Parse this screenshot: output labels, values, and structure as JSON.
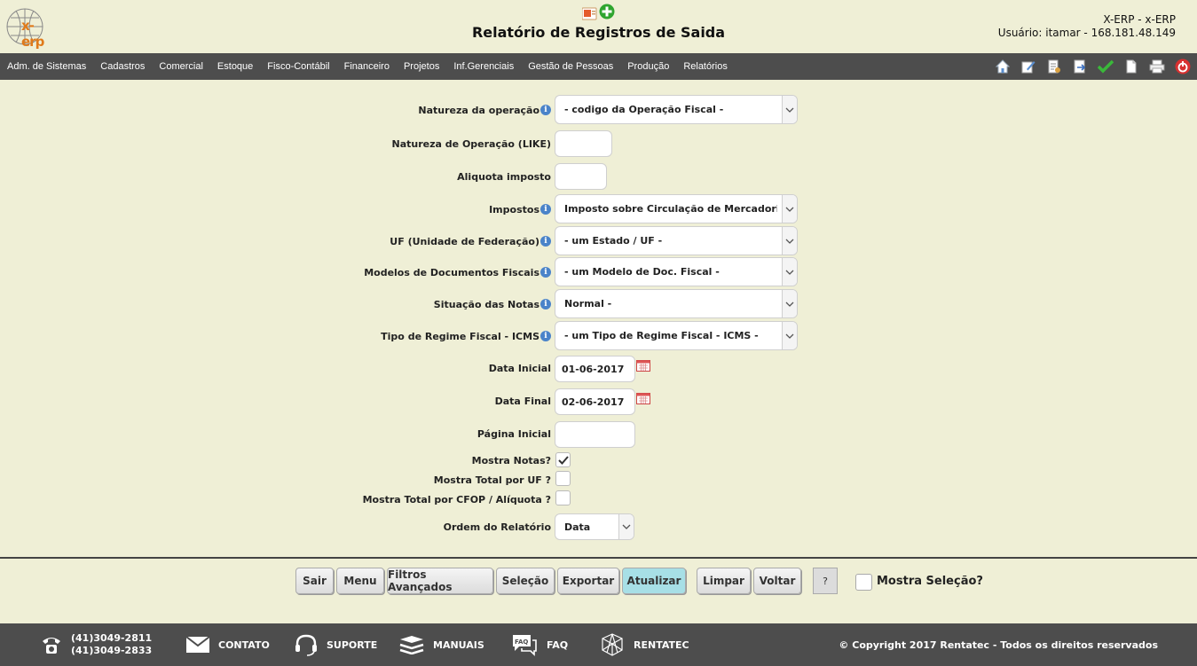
{
  "header": {
    "logo_text": "x-erp",
    "title": "Relatório de Registros de Saida",
    "user_line1": "X-ERP - x-ERP",
    "user_line2": "Usuário: itamar - 168.181.48.149"
  },
  "menu": [
    "Adm. de Sistemas",
    "Cadastros",
    "Comercial",
    "Estoque",
    "Fisco-Contábil",
    "Financeiro",
    "Projetos",
    "Inf.Gerenciais",
    "Gestão de Pessoas",
    "Produção",
    "Relatórios"
  ],
  "toolbar_icons": [
    "home-icon",
    "edit-icon",
    "document-icon",
    "export-icon",
    "check-icon",
    "page-icon",
    "print-icon",
    "power-icon"
  ],
  "form": {
    "natureza_label": "Natureza da operação",
    "natureza_value": "- codigo da Operação Fiscal -",
    "natureza_like_label": "Natureza de Operação (LIKE)",
    "natureza_like_value": "",
    "aliquota_label": "Aliquota imposto",
    "aliquota_value": "",
    "impostos_label": "Impostos",
    "impostos_value": "Imposto sobre Circulação de Mercadoria e Serviços",
    "uf_label": "UF (Unidade de Federação)",
    "uf_value": "- um Estado / UF -",
    "modelos_label": "Modelos de Documentos Fiscais",
    "modelos_value": "- um Modelo de Doc. Fiscal -",
    "situacao_label": "Situação das Notas",
    "situacao_value": "Normal -",
    "regime_label": "Tipo de Regime Fiscal - ICMS",
    "regime_value": "- um Tipo de Regime Fiscal - ICMS -",
    "data_inicial_label": "Data Inicial",
    "data_inicial_value": "01-06-2017",
    "data_final_label": "Data Final",
    "data_final_value": "02-06-2017",
    "pagina_label": "Página Inicial",
    "pagina_value": "",
    "mostra_notas_label": "Mostra Notas?",
    "mostra_notas_checked": true,
    "mostra_uf_label": "Mostra Total por UF ?",
    "mostra_uf_checked": false,
    "mostra_cfop_label": "Mostra Total por CFOP / Alíquota ?",
    "mostra_cfop_checked": false,
    "ordem_label": "Ordem do Relatório",
    "ordem_value": "Data",
    "info_glyph": "i"
  },
  "buttons": {
    "sair": "Sair",
    "menu": "Menu",
    "filtros": "Filtros Avançados",
    "selecao": "Seleção",
    "exportar": "Exportar",
    "atualizar": "Atualizar",
    "limpar": "Limpar",
    "voltar": "Voltar",
    "help": "?",
    "mostra_selecao": "Mostra Seleção?"
  },
  "footer": {
    "phone1": "(41)3049-2811",
    "phone2": "(41)3049-2833",
    "contato": "CONTATO",
    "suporte": "SUPORTE",
    "manuais": "MANUAIS",
    "faq": "FAQ",
    "faq_icon_text": "FAQ",
    "rentatec": "RENTATEC",
    "copyright": "© Copyright 2017 Rentatec - Todos os direitos reservados"
  },
  "colors": {
    "background": "#efefd6",
    "bar": "#4d4d4d",
    "active_button": "#a7dfe6",
    "info": "#4a83c9"
  }
}
